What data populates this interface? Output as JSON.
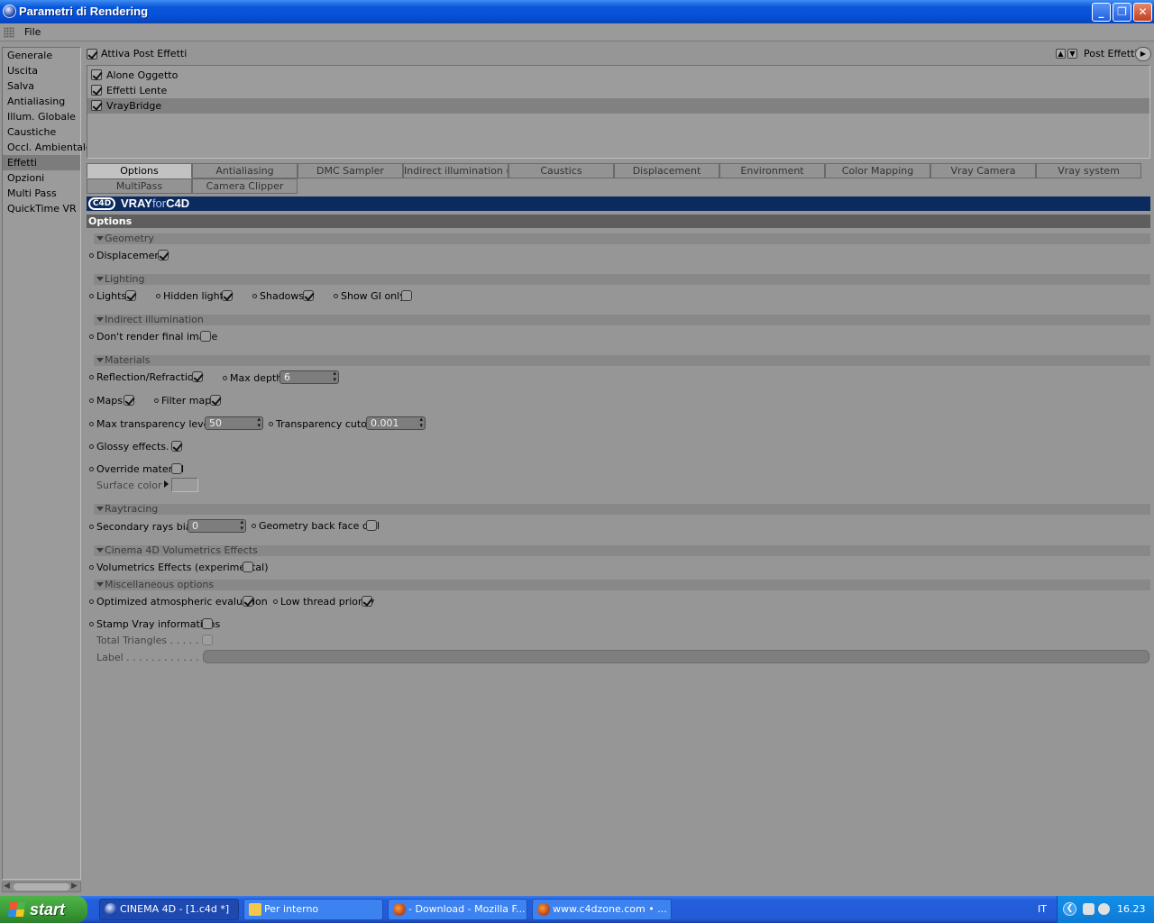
{
  "window": {
    "title": "Parametri di Rendering",
    "minimize": "_",
    "restore": "❐",
    "close": "✕"
  },
  "menu": {
    "file": "File"
  },
  "left_nav": {
    "items": [
      {
        "label": "Generale"
      },
      {
        "label": "Uscita"
      },
      {
        "label": "Salva"
      },
      {
        "label": "Antialiasing"
      },
      {
        "label": "Illum. Globale"
      },
      {
        "label": "Caustiche"
      },
      {
        "label": "Occl. Ambientale"
      },
      {
        "label": "Effetti",
        "selected": true
      },
      {
        "label": "Opzioni"
      },
      {
        "label": "Multi Pass"
      },
      {
        "label": "QuickTime VR"
      }
    ]
  },
  "post_effects": {
    "enable_label": "Attiva Post Effetti",
    "enabled": true,
    "menu_label": "Post Effetti",
    "list": [
      {
        "label": "Alone Oggetto",
        "checked": true
      },
      {
        "label": "Effetti Lente",
        "checked": true
      },
      {
        "label": "VrayBridge",
        "checked": true,
        "selected": true
      }
    ]
  },
  "tabs": {
    "row1": [
      "Options",
      "Antialiasing",
      "DMC Sampler",
      "Indirect illumination (GI)",
      "Caustics",
      "Displacement",
      "Environment",
      "Color Mapping",
      "Vray Camera",
      "Vray system"
    ],
    "row2": [
      "MultiPass",
      "Camera Clipper"
    ],
    "active": "Options"
  },
  "vray": {
    "logo": "C4D",
    "brand_a": "VRAY",
    "brand_b": "for",
    "brand_c": "C4D"
  },
  "options": {
    "header": "Options",
    "geometry": {
      "title": "Geometry",
      "displacement": "Displacement"
    },
    "lighting": {
      "title": "Lighting",
      "lights": "Lights",
      "hidden_lights": "Hidden lights",
      "shadows": "Shadows",
      "show_gi_only": "Show GI only"
    },
    "indirect": {
      "title": "Indirect illumination",
      "dont_render": "Don't render final image"
    },
    "materials": {
      "title": "Materials",
      "reflection": "Reflection/Refraction",
      "max_depth": "Max depth",
      "max_depth_value": "6",
      "maps": "Maps",
      "filter_maps": "Filter maps",
      "max_transp": "Max transparency levels",
      "max_transp_value": "50",
      "transp_cutoff": "Transparency cutoff",
      "transp_cutoff_value": "0.001",
      "glossy": "Glossy effects. .",
      "override": "Override material",
      "surface_color": "Surface color"
    },
    "raytracing": {
      "title": "Raytracing",
      "secondary_bias": "Secondary rays bias",
      "secondary_bias_value": "0",
      "backface": "Geometry back face cull"
    },
    "volumetrics": {
      "title": "Cinema 4D Volumetrics Effects",
      "vol_effects": "Volumetrics Effects (experimental)"
    },
    "misc": {
      "title": "Miscellaneous options",
      "optimized": "Optimized atmospheric evaluation",
      "low_thread": "Low thread priority",
      "stamp": "Stamp Vray informations",
      "total_triangles": "Total Triangles . . . . . . .",
      "label": "Label . . . . . . . . . . . . . ."
    }
  },
  "taskbar": {
    "start": "start",
    "tasks": [
      {
        "label": "CINEMA 4D - [1.c4d *]",
        "active": true
      },
      {
        "label": "Per interno"
      },
      {
        "label": "- Download - Mozilla F..."
      },
      {
        "label": "www.c4dzone.com • ..."
      }
    ],
    "lang": "IT",
    "clock": "16.23"
  },
  "colors": {
    "panel_gray": "#969696",
    "vray_blue": "#0b2a5e",
    "xp_blue": "#245edb",
    "start_green": "#3a9a36"
  }
}
